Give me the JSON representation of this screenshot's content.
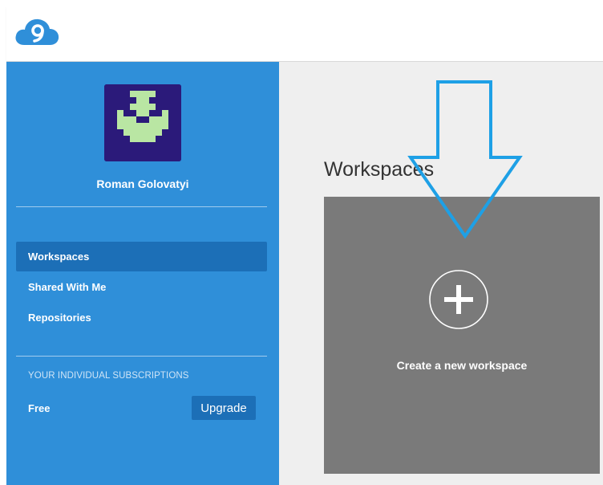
{
  "header": {
    "logo_icon": "cloud9-logo-icon"
  },
  "sidebar": {
    "user_name": "Roman Golovatyi",
    "avatar_icon": "pixel-avatar-icon",
    "nav": [
      {
        "label": "Workspaces",
        "active": true
      },
      {
        "label": "Shared With Me",
        "active": false
      },
      {
        "label": "Repositories",
        "active": false
      }
    ],
    "subscriptions_heading": "YOUR INDIVIDUAL SUBSCRIPTIONS",
    "plan_label": "Free",
    "upgrade_label": "Upgrade"
  },
  "main": {
    "title": "Workspaces",
    "create_label": "Create a new workspace",
    "plus_icon": "plus-circle-icon"
  },
  "annotation": {
    "arrow_icon": "down-arrow-icon",
    "arrow_color": "#1ea0e6"
  },
  "colors": {
    "sidebar": "#2f8fd9",
    "active_nav": "#1c6fb7",
    "card": "#7a7a7a",
    "main_bg": "#efefef"
  }
}
